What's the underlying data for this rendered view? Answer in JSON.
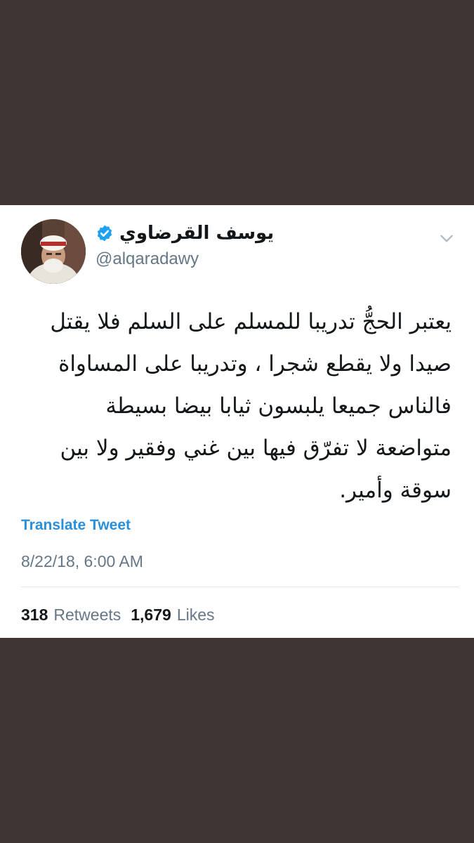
{
  "tweet": {
    "author": {
      "display_name": "يوسف القرضاوي",
      "handle": "@alqaradawy",
      "verified": true
    },
    "text_lines": [
      "يعتبر الحجُّ تدريبا للمسلم على السلم فلا يقتل",
      "صيدا ولا يقطع شجرا ، وتدريبا على المساواة",
      "فالناس جميعا يلبسون ثيابا بيضا بسيطة",
      "متواضعة لا تفرّق فيها بين غني وفقير ولا بين",
      "سوقة وأمير."
    ],
    "translate_label": "Translate Tweet",
    "timestamp": "8/22/18, 6:00 AM",
    "retweets": {
      "count": "318",
      "label": "Retweets"
    },
    "likes": {
      "count": "1,679",
      "label": "Likes"
    }
  },
  "icons": {
    "verified": "verified-badge-icon",
    "menu": "chevron-down-icon"
  },
  "colors": {
    "background": "#3f3535",
    "card": "#ffffff",
    "link_blue": "#2a8fdb",
    "verified_blue": "#1da1f2",
    "text_primary": "#14171a",
    "text_secondary": "#657786"
  }
}
